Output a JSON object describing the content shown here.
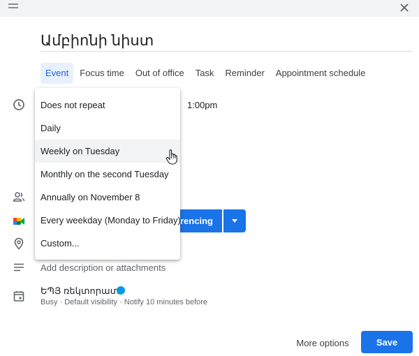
{
  "title": "Ամբիոնի նիստ",
  "tabs": [
    {
      "label": "Event",
      "active": true
    },
    {
      "label": "Focus time"
    },
    {
      "label": "Out of office"
    },
    {
      "label": "Task"
    },
    {
      "label": "Reminder"
    },
    {
      "label": "Appointment schedule"
    }
  ],
  "time": {
    "end": "1:00pm"
  },
  "conference": {
    "label_visible": "rencing"
  },
  "description": {
    "placeholder": "Add description or attachments"
  },
  "calendar": {
    "name": "ԵՊՅ ռեկտորատ",
    "color": "#039be5",
    "details": "Busy · Default visibility · Notify 10 minutes before"
  },
  "repeat_menu": {
    "items": [
      "Does not repeat",
      "Daily",
      "Weekly on Tuesday",
      "Monthly on the second Tuesday",
      "Annually on November 8",
      "Every weekday (Monday to Friday)",
      "Custom..."
    ],
    "hovered": "Weekly on Tuesday"
  },
  "footer": {
    "more_options": "More options",
    "save": "Save"
  },
  "colors": {
    "accent": "#1a73e8",
    "tab_active_bg": "#e8f0fe",
    "topbar": "#f1f3f4"
  },
  "icons": [
    "drag-handle-icon",
    "close-icon",
    "clock-icon",
    "people-icon",
    "meet-icon",
    "location-icon",
    "description-icon",
    "calendar-icon",
    "hand-cursor-icon"
  ]
}
